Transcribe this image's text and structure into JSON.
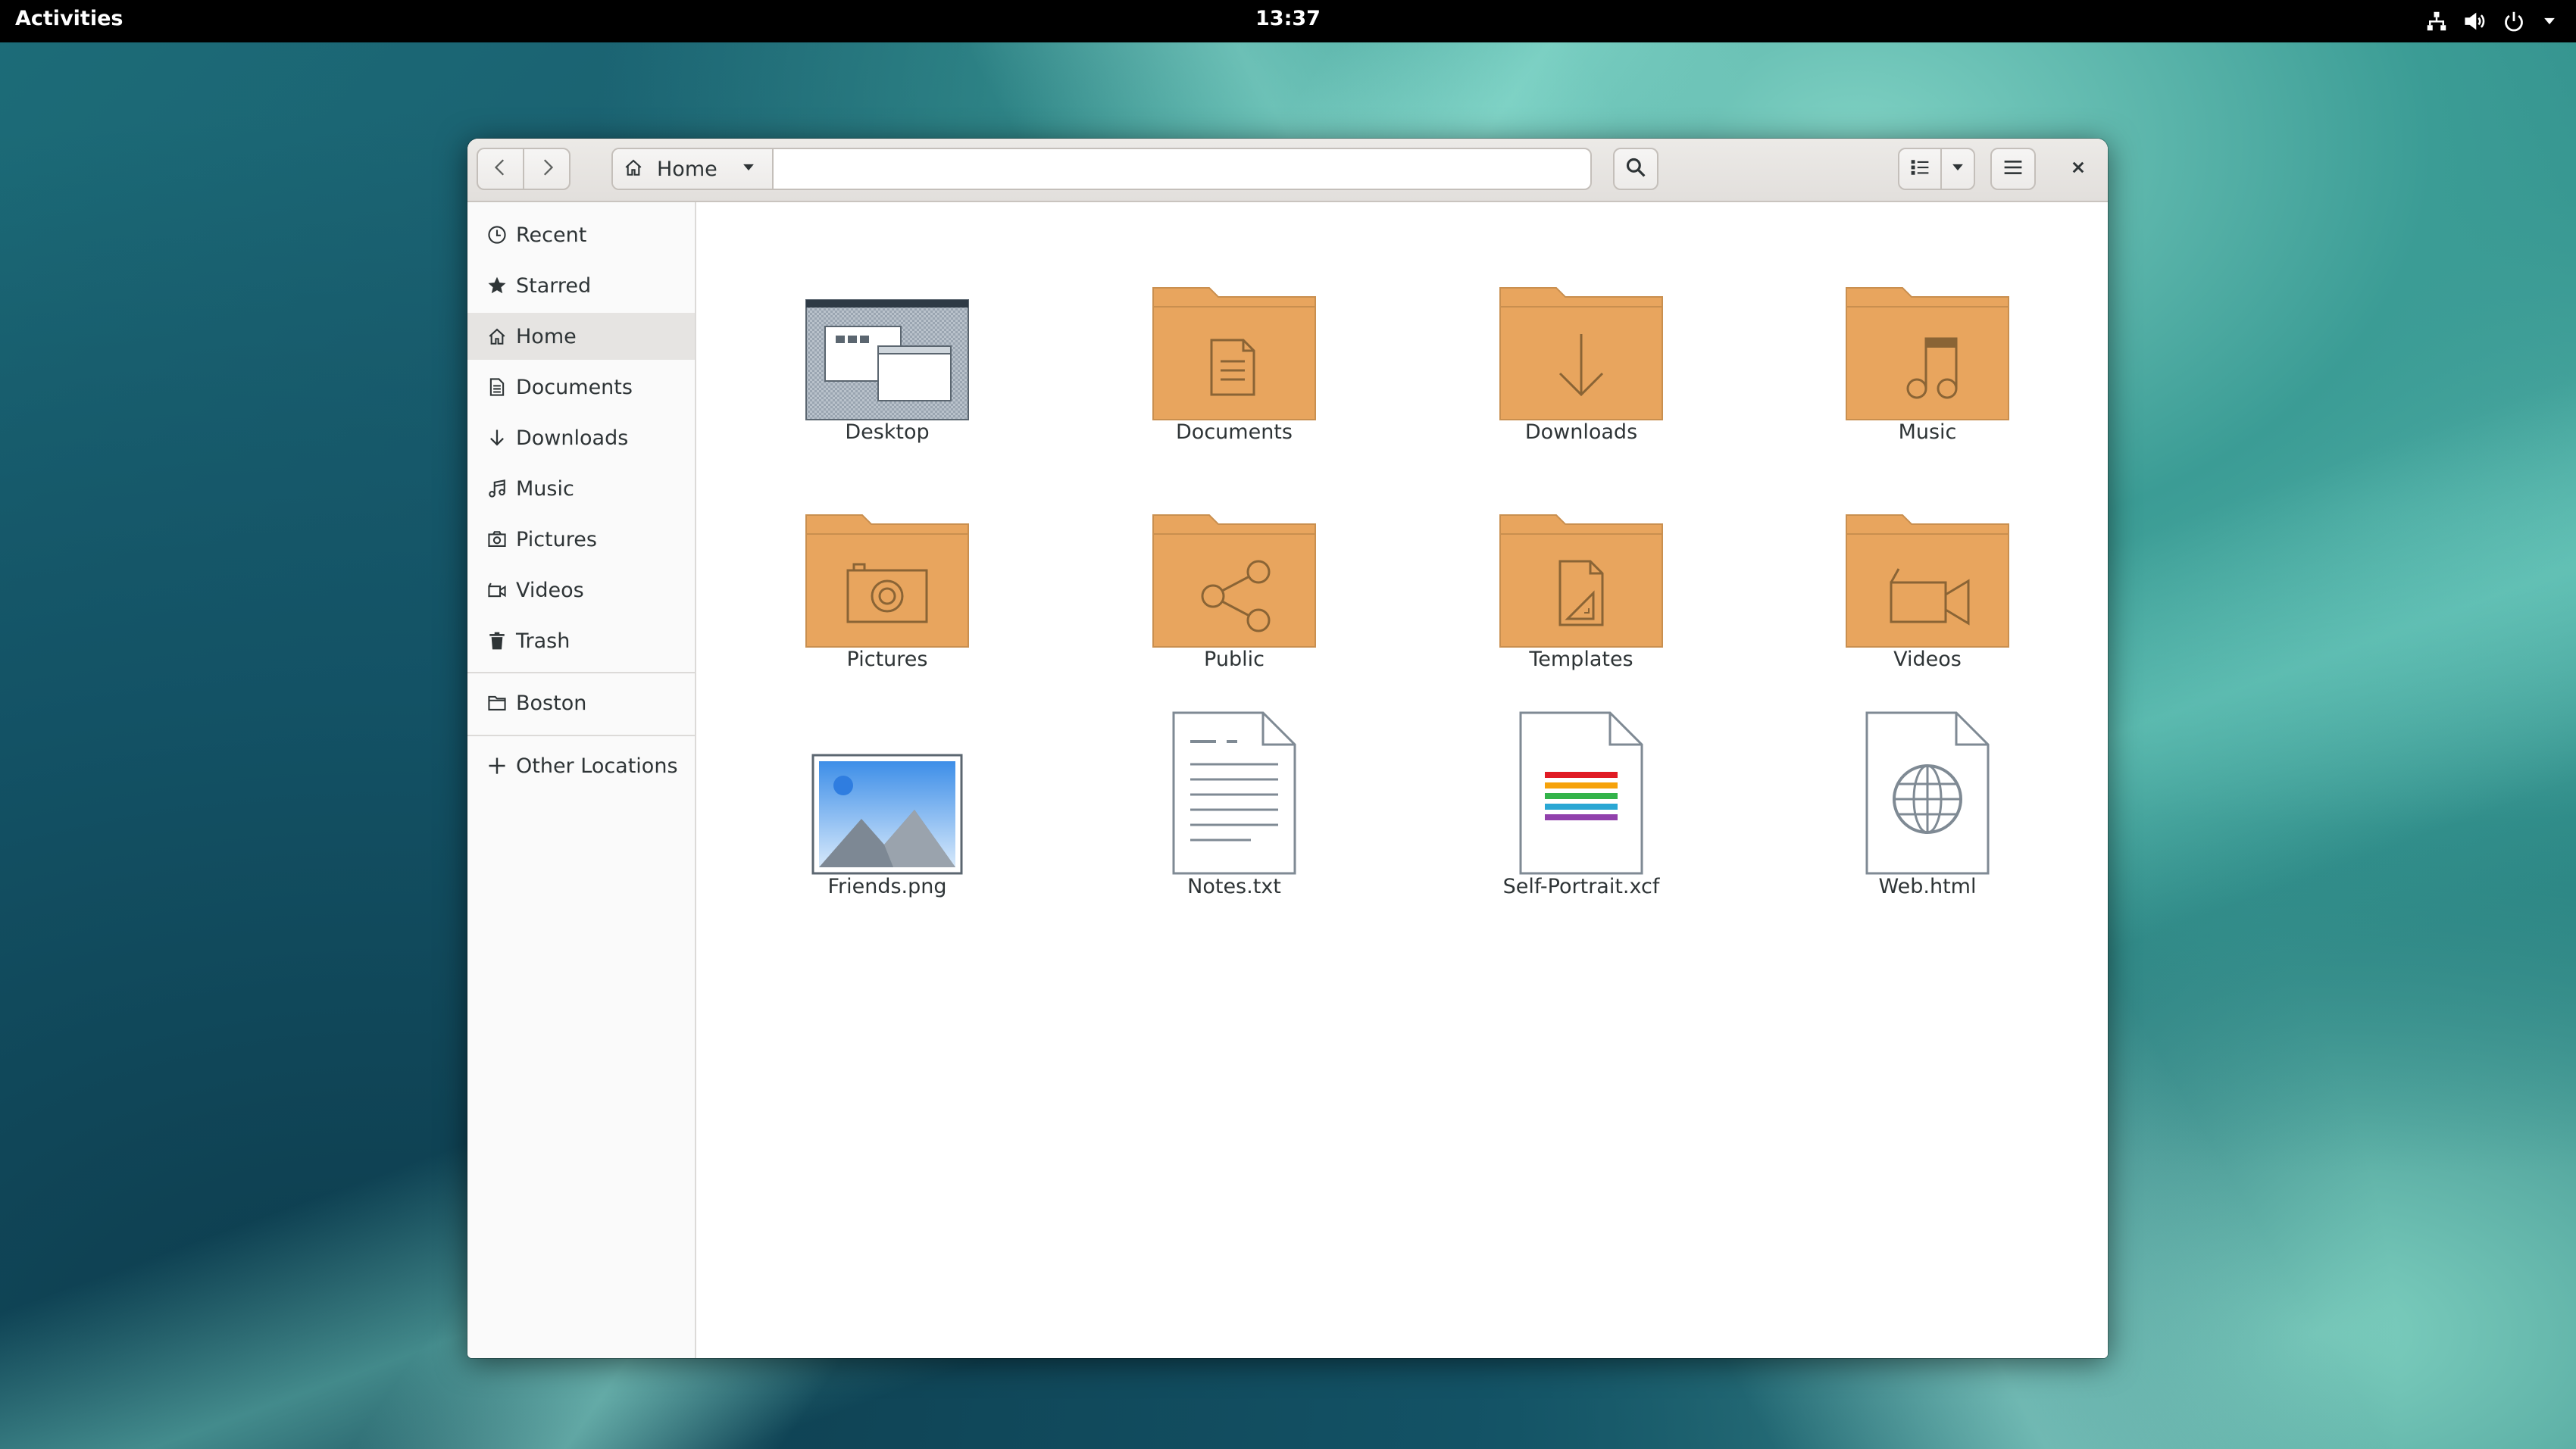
{
  "topbar": {
    "activities": "Activities",
    "clock": "13:37",
    "status_icons": [
      "network-icon",
      "volume-icon",
      "power-icon",
      "chevron-down-icon"
    ]
  },
  "window": {
    "nav": {
      "back_icon": "go-back-icon",
      "forward_icon": "go-forward-icon"
    },
    "path": {
      "current": "Home",
      "home_icon": "home-icon",
      "dropdown_icon": "chevron-down-icon"
    },
    "search_icon": "search-icon",
    "view_icon": "list-view-icon",
    "view_dropdown_icon": "chevron-down-icon",
    "menu_icon": "hamburger-menu-icon",
    "close_icon": "close-icon"
  },
  "sidebar": {
    "items": [
      {
        "label": "Recent",
        "icon": "clock-icon"
      },
      {
        "label": "Starred",
        "icon": "star-icon"
      },
      {
        "label": "Home",
        "icon": "home-icon",
        "active": true
      },
      {
        "label": "Documents",
        "icon": "document-icon"
      },
      {
        "label": "Downloads",
        "icon": "download-arrow-icon"
      },
      {
        "label": "Music",
        "icon": "music-note-icon"
      },
      {
        "label": "Pictures",
        "icon": "camera-icon"
      },
      {
        "label": "Videos",
        "icon": "video-camera-icon"
      },
      {
        "label": "Trash",
        "icon": "trash-icon"
      }
    ],
    "bookmarks": [
      {
        "label": "Boston",
        "icon": "folder-icon"
      }
    ],
    "other_locations": {
      "label": "Other Locations",
      "icon": "plus-icon"
    }
  },
  "files": [
    {
      "name": "Desktop",
      "icon": "desktop-folder-icon"
    },
    {
      "name": "Documents",
      "icon": "documents-folder-icon"
    },
    {
      "name": "Downloads",
      "icon": "downloads-folder-icon"
    },
    {
      "name": "Music",
      "icon": "music-folder-icon"
    },
    {
      "name": "Pictures",
      "icon": "pictures-folder-icon"
    },
    {
      "name": "Public",
      "icon": "public-share-folder-icon"
    },
    {
      "name": "Templates",
      "icon": "templates-folder-icon"
    },
    {
      "name": "Videos",
      "icon": "videos-folder-icon"
    },
    {
      "name": "Friends.png",
      "icon": "image-file-icon"
    },
    {
      "name": "Notes.txt",
      "icon": "text-file-icon"
    },
    {
      "name": "Self-Portrait.xcf",
      "icon": "xcf-image-file-icon"
    },
    {
      "name": "Web.html",
      "icon": "html-file-icon"
    }
  ],
  "colors": {
    "folder": "#e8a55e",
    "folder_dark": "#c98f4f",
    "topbar": "#000000",
    "sidebar_active": "#e6e4e2"
  }
}
